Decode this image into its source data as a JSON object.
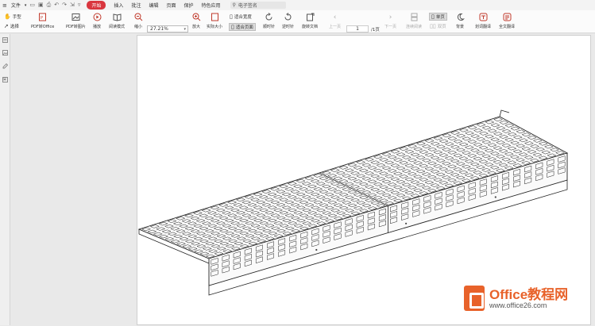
{
  "menubar": {
    "file": "文件",
    "tabs": [
      "开始",
      "插入",
      "批注",
      "编辑",
      "页面",
      "保护",
      "特色应用"
    ],
    "active_tab": "开始",
    "search_placeholder": "电子签名"
  },
  "ribbon": {
    "hand": "手型",
    "select": "选择",
    "pdf_to_office": "PDF转Office",
    "pdf_to_image": "PDF转图片",
    "play": "播放",
    "read_mode": "阅读模式",
    "zoom_out": "缩小",
    "zoom_value": "27.21%",
    "zoom_in": "放大",
    "actual_size": "实际大小",
    "fit_width": "适合宽度",
    "fit_page": "适合页面",
    "rotate_cw": "顺时针",
    "rotate_ccw": "逆时针",
    "rotate_doc": "旋转文档",
    "prev_page": "上一页",
    "page_current": "1",
    "page_total": "/1页",
    "next_page": "下一页",
    "continuous": "连续阅读",
    "single_page": "单页",
    "double_page": "双页",
    "background": "背景",
    "word_translate": "划词翻译",
    "full_translate": "全文翻译"
  },
  "watermark": {
    "brand": "Office教程网",
    "url": "www.office26.com"
  },
  "colors": {
    "accent": "#d9363e",
    "watermark": "#e8622a"
  }
}
